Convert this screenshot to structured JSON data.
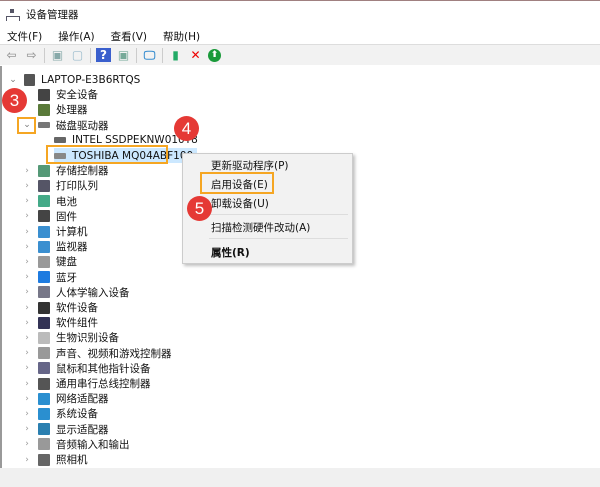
{
  "window": {
    "title": "设备管理器"
  },
  "menu": [
    "文件(F)",
    "操作(A)",
    "查看(V)",
    "帮助(H)"
  ],
  "toolbar": [
    {
      "icon": "back-arrow-icon",
      "g": "⇦",
      "c": "#999"
    },
    {
      "icon": "forward-arrow-icon",
      "g": "⇨",
      "c": "#999"
    },
    {
      "sep": true
    },
    {
      "icon": "show-hide-tree-icon",
      "g": "▣",
      "c": "#8aa"
    },
    {
      "icon": "properties-icon",
      "g": "▢",
      "c": "#9bc"
    },
    {
      "sep": true
    },
    {
      "icon": "help-icon",
      "g": "?",
      "c": "#fff",
      "bg": "#3a5fcd"
    },
    {
      "icon": "action-pane-icon",
      "g": "▣",
      "c": "#7a9"
    },
    {
      "sep": true
    },
    {
      "icon": "scan-hardware-icon",
      "g": "🖵",
      "c": "#3a8fd0"
    },
    {
      "sep": true
    },
    {
      "icon": "update-driver-icon",
      "g": "▮",
      "c": "#2a6"
    },
    {
      "icon": "uninstall-x-icon",
      "g": "✕",
      "c": "#e00"
    },
    {
      "icon": "enable-device-icon",
      "g": "⬆",
      "c": "#fff",
      "bg": "#1a9a3a",
      "round": true
    }
  ],
  "tree": {
    "root": "LAPTOP-E3B6RTQS",
    "items": [
      {
        "label": "安全设备",
        "icon": "security-device-icon",
        "color": "#444",
        "chev": ""
      },
      {
        "label": "处理器",
        "icon": "processor-icon",
        "color": "#5a7a3a",
        "chev": ""
      },
      {
        "label": "磁盘驱动器",
        "icon": "disk-drive-icon",
        "color": "#777",
        "chev": "⌄",
        "expanded": true
      },
      {
        "label": "INTEL SSDPEKNW010T8",
        "icon": "disk-icon",
        "color": "#666",
        "child": true
      },
      {
        "label": "TOSHIBA MQ04ABF100",
        "icon": "disabled-disk-icon",
        "color": "#888",
        "child": true,
        "selected": true
      },
      {
        "label": "存储控制器",
        "icon": "storage-controller-icon",
        "color": "#597"
      },
      {
        "label": "打印队列",
        "icon": "print-queue-icon",
        "color": "#556"
      },
      {
        "label": "电池",
        "icon": "battery-icon",
        "color": "#4a8"
      },
      {
        "label": "固件",
        "icon": "firmware-icon",
        "color": "#444"
      },
      {
        "label": "计算机",
        "icon": "computer-icon",
        "color": "#3a8fd0"
      },
      {
        "label": "监视器",
        "icon": "monitor-icon",
        "color": "#3a8fd0"
      },
      {
        "label": "键盘",
        "icon": "keyboard-icon",
        "color": "#999"
      },
      {
        "label": "蓝牙",
        "icon": "bluetooth-icon",
        "color": "#1e7be0"
      },
      {
        "label": "人体学输入设备",
        "icon": "hid-icon",
        "color": "#778"
      },
      {
        "label": "软件设备",
        "icon": "software-device-icon",
        "color": "#333"
      },
      {
        "label": "软件组件",
        "icon": "software-component-icon",
        "color": "#335"
      },
      {
        "label": "生物识别设备",
        "icon": "biometric-icon",
        "color": "#bbb"
      },
      {
        "label": "声音、视频和游戏控制器",
        "icon": "sound-icon",
        "color": "#999"
      },
      {
        "label": "鼠标和其他指针设备",
        "icon": "mouse-icon",
        "color": "#668"
      },
      {
        "label": "通用串行总线控制器",
        "icon": "usb-icon",
        "color": "#555"
      },
      {
        "label": "网络适配器",
        "icon": "network-adapter-icon",
        "color": "#2a8fd0"
      },
      {
        "label": "系统设备",
        "icon": "system-device-icon",
        "color": "#2a8fd0"
      },
      {
        "label": "显示适配器",
        "icon": "display-adapter-icon",
        "color": "#2a7fb0"
      },
      {
        "label": "音频输入和输出",
        "icon": "audio-io-icon",
        "color": "#999"
      },
      {
        "label": "照相机",
        "icon": "camera-icon",
        "color": "#666"
      }
    ]
  },
  "context_menu": {
    "items": [
      "更新驱动程序(P)",
      "启用设备(E)",
      "卸载设备(U)",
      "扫描检测硬件改动(A)",
      "属性(R)"
    ]
  },
  "annotations": {
    "step3": "3",
    "step4": "4",
    "step5": "5",
    "highlight_color": "#f5a623",
    "badge_color": "#e53935"
  }
}
